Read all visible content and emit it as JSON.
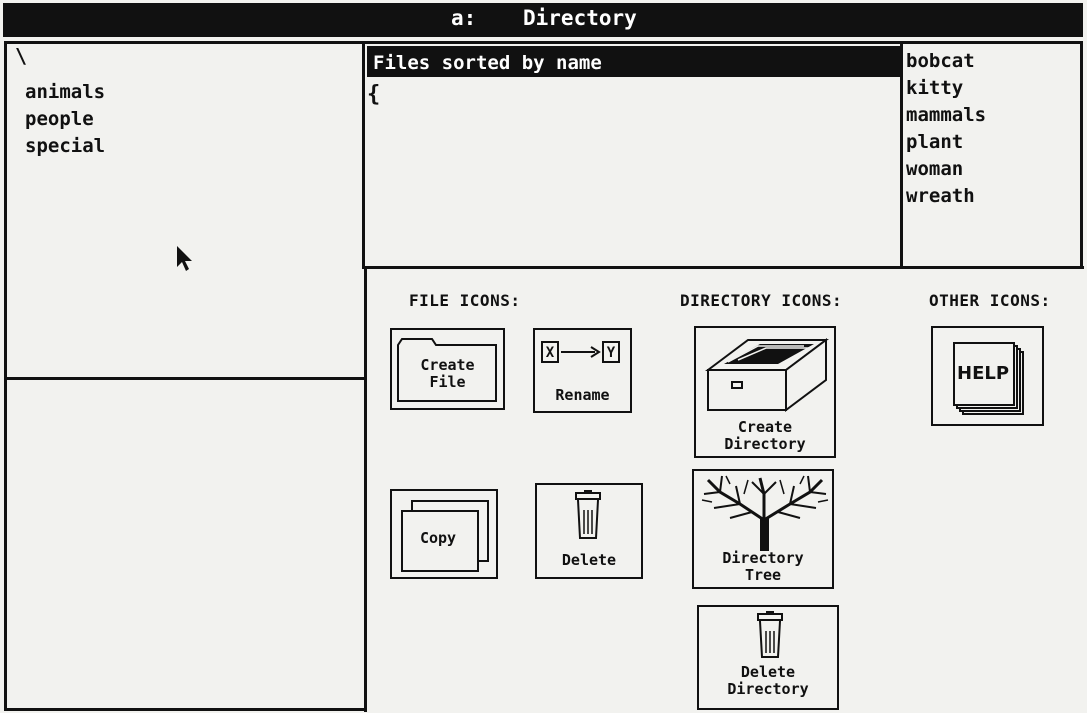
{
  "window": {
    "drive": "a:",
    "title": "Directory"
  },
  "tree": {
    "root_glyph": "\\",
    "items": [
      "animals",
      "people",
      "special"
    ]
  },
  "files": {
    "sort_label": "Files sorted by name",
    "cursor_glyph": "{"
  },
  "file_list": [
    "bobcat",
    "kitty",
    "mammals",
    "plant",
    "woman",
    "wreath"
  ],
  "palette": {
    "file_header": "FILE ICONS:",
    "dir_header": "DIRECTORY ICONS:",
    "other_header": "OTHER ICONS:",
    "create_file": {
      "line1": "Create",
      "line2": "File"
    },
    "rename": {
      "label": "Rename",
      "from": "X",
      "to": "Y"
    },
    "copy": {
      "label": "Copy"
    },
    "delete": {
      "label": "Delete"
    },
    "create_dir": {
      "line1": "Create",
      "line2": "Directory"
    },
    "dir_tree": {
      "line1": "Directory",
      "line2": "Tree"
    },
    "delete_dir": {
      "line1": "Delete",
      "line2": "Directory"
    },
    "help": {
      "label": "HELP"
    }
  },
  "colors": {
    "ink": "#111111",
    "paper": "#f2f2ef"
  }
}
